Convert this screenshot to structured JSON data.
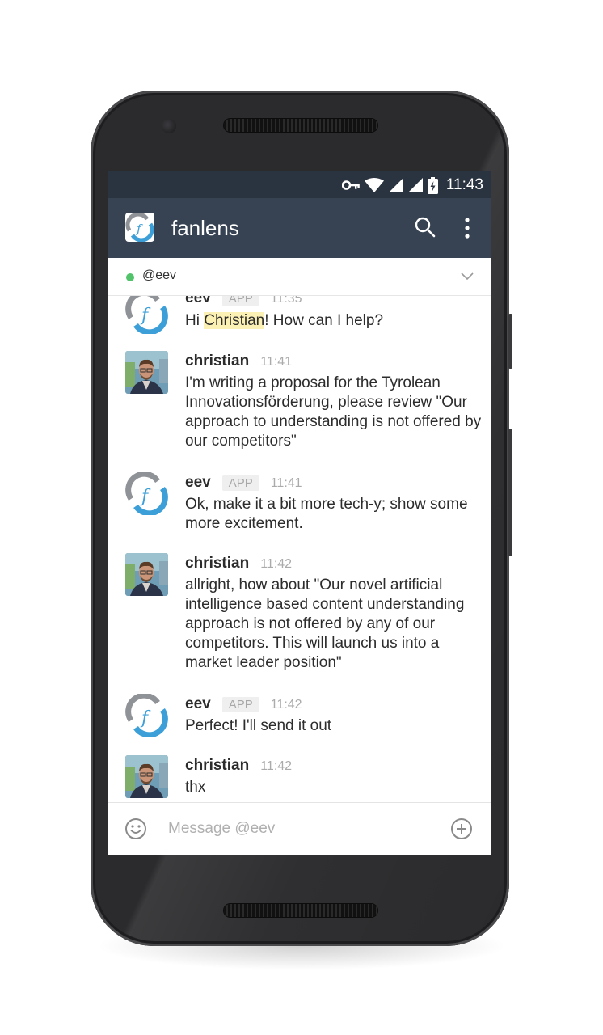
{
  "status_bar": {
    "time": "11:43"
  },
  "app_bar": {
    "title": "fanlens"
  },
  "channel": {
    "name": "@eev"
  },
  "messages": [
    {
      "author": "eev",
      "badge": "APP",
      "time": "11:35",
      "text_before": "Hi ",
      "highlight": "Christian",
      "text_after": "! How can I help?"
    },
    {
      "author": "christian",
      "time": "11:41",
      "text": "I'm writing a proposal for the Tyrolean Innovationsförderung, please review \"Our approach to understanding is not offered by our competitors\""
    },
    {
      "author": "eev",
      "badge": "APP",
      "time": "11:41",
      "text": "Ok, make it a bit more tech-y; show some more excitement."
    },
    {
      "author": "christian",
      "time": "11:42",
      "text": "allright, how about \"Our novel artificial intelligence based content understanding approach is not offered by any of our competitors. This will launch us into a market leader position\""
    },
    {
      "author": "eev",
      "badge": "APP",
      "time": "11:42",
      "text": "Perfect! I'll send it out"
    },
    {
      "author": "christian",
      "time": "11:42",
      "text": "thx"
    }
  ],
  "composer": {
    "placeholder": "Message @eev"
  },
  "colors": {
    "status_bar": "#2a3340",
    "app_bar": "#374353",
    "presence": "#52c36b",
    "highlight": "#fcf1b5",
    "logo_blue": "#3d9fd8",
    "logo_gray": "#8f9296"
  },
  "icons": [
    "key-icon",
    "wifi-icon",
    "signal-icon",
    "battery-icon",
    "search-icon",
    "overflow-menu-icon",
    "chevron-down-icon",
    "emoji-icon",
    "add-icon",
    "fanlens-logo-icon",
    "user-photo-avatar"
  ]
}
